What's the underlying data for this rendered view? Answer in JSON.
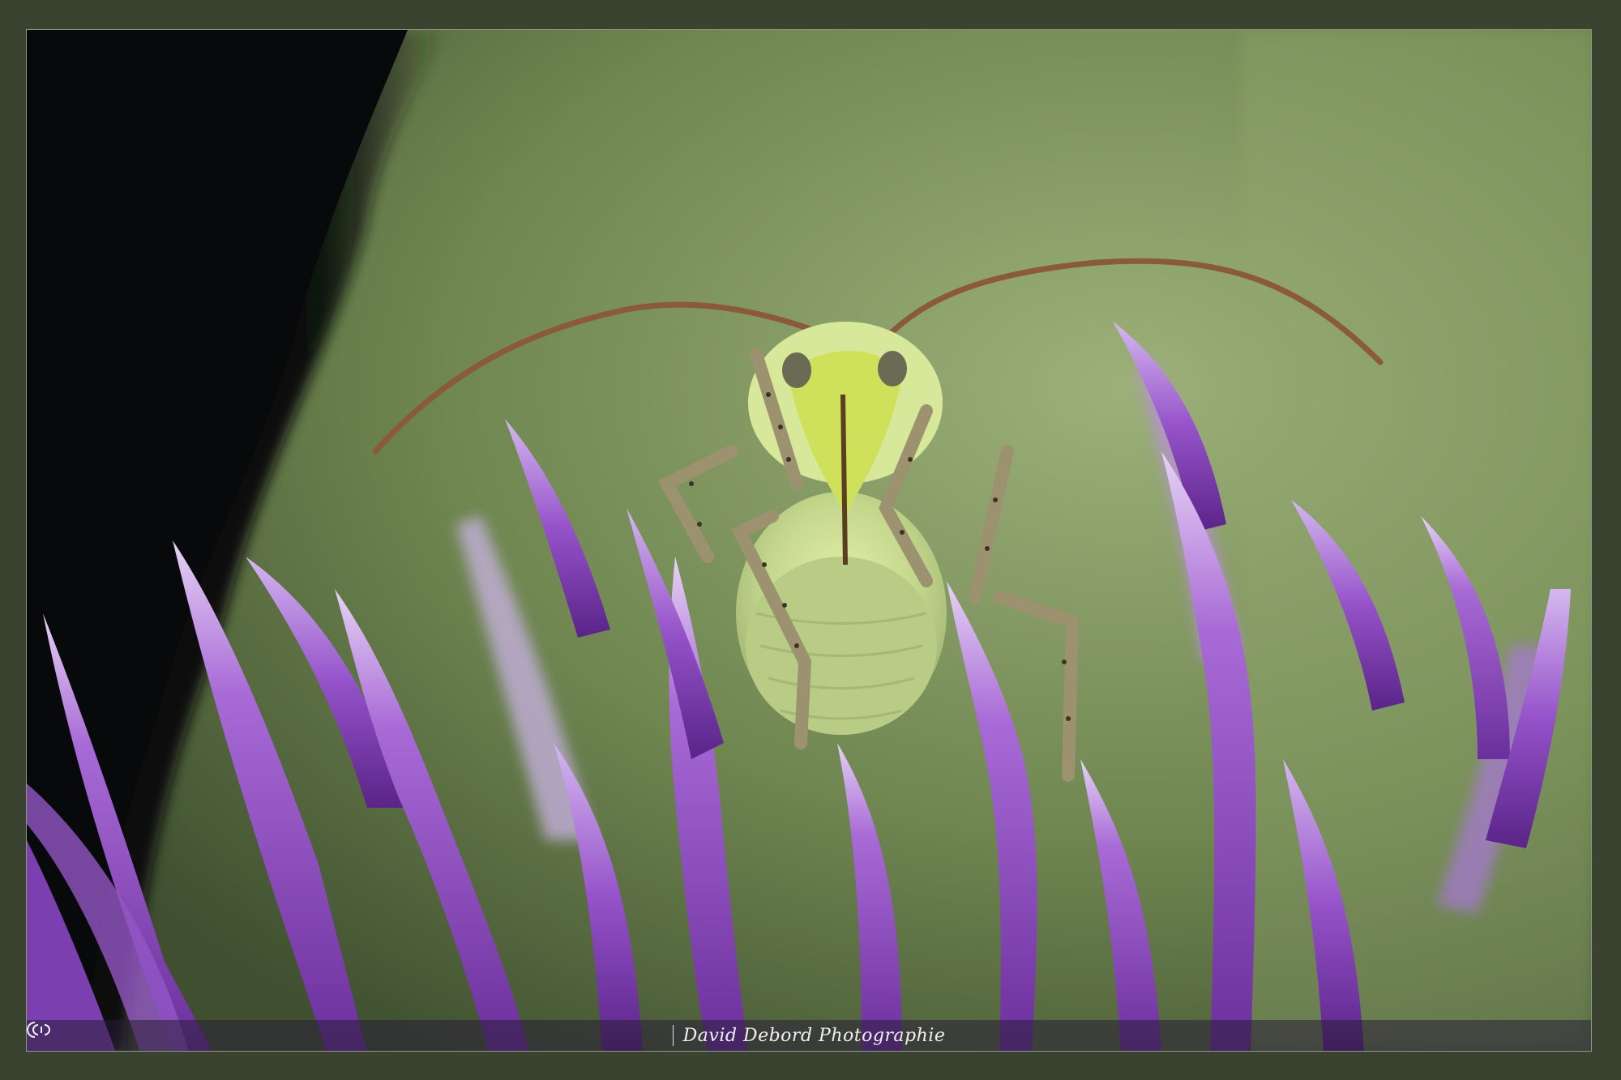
{
  "photo": {
    "subject": "",
    "colors": {
      "background_green": "#7f9a5e",
      "shadow": "#0d0f0b",
      "petal_purple": "#9a5cc8",
      "petal_light": "#d9c3ee",
      "insect_green": "#c9de8a",
      "antenna_brown": "#8a5a3a"
    }
  },
  "credit": {
    "logo_icon": "camera-aperture-icon",
    "text": "David Debord Photographie"
  }
}
